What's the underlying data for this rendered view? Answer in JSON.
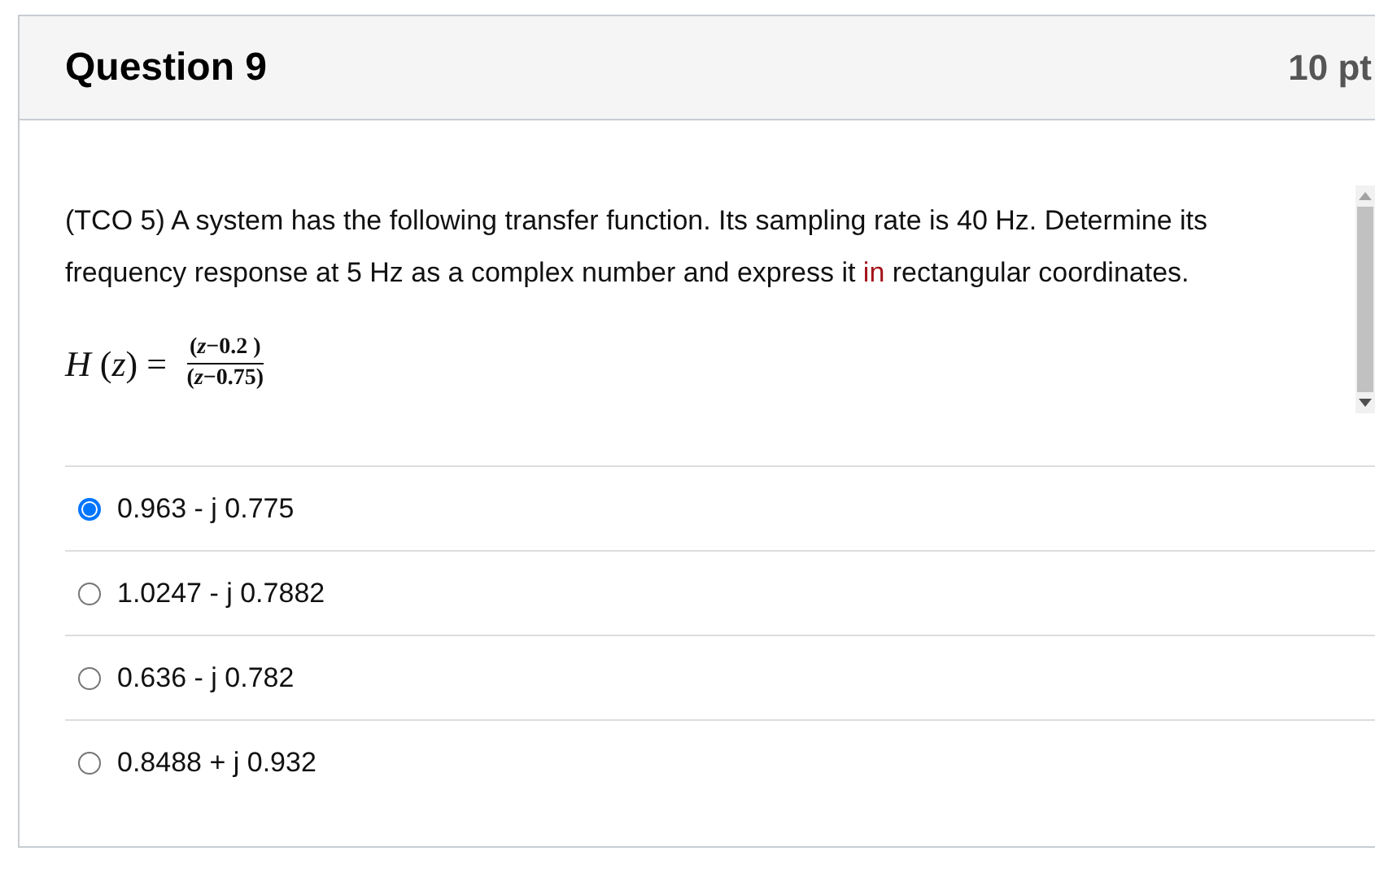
{
  "question": {
    "title": "Question 9",
    "points": "10 pt"
  },
  "prompt": [
    {
      "text": "(TCO 5) A system has the following transfer function. Its sampling rate is 40 Hz. Determine its frequency response at 5 Hz as a complex number and express it ",
      "kind": "plain"
    },
    {
      "text": "in",
      "kind": "highlight"
    },
    {
      "text": " rectangular coordinates.",
      "kind": "plain"
    }
  ],
  "formula": {
    "lhs": "*H* (*z*) =",
    "numerator": "(*z*−0.2 )",
    "denominator": "(*z*−0.75)"
  },
  "answers": [
    {
      "label": "0.963 - j 0.775",
      "selected": true
    },
    {
      "label": "1.0247 - j 0.7882",
      "selected": false
    },
    {
      "label": "0.636 - j 0.782",
      "selected": false
    },
    {
      "label": "0.8488 + j 0.932",
      "selected": false
    }
  ]
}
